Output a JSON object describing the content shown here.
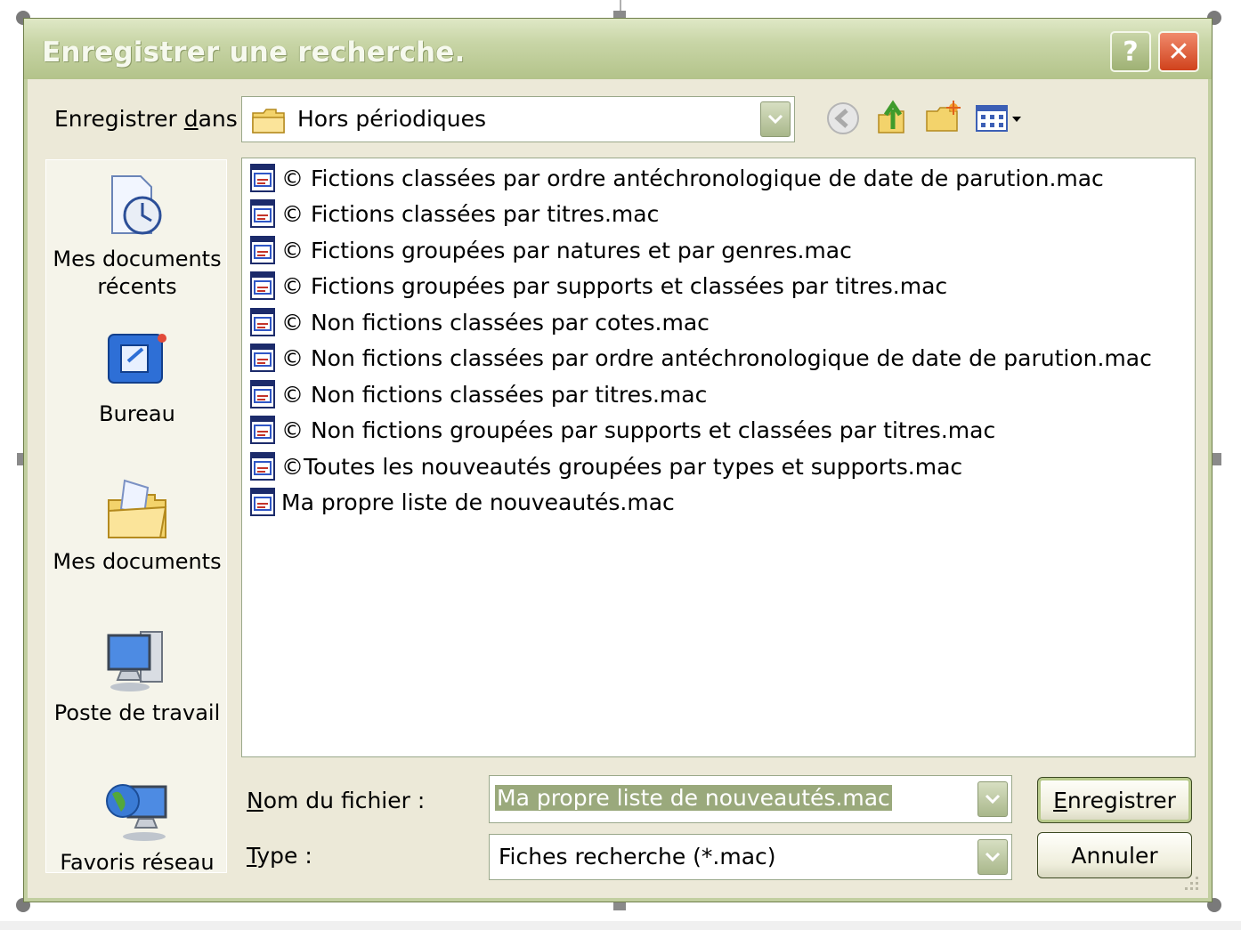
{
  "window": {
    "title": "Enregistrer une recherche."
  },
  "titlebar": {
    "help_label": "?",
    "close_label": "✕"
  },
  "toolbar": {
    "save_in_label_pre": "Enregistrer ",
    "save_in_label_accel": "d",
    "save_in_label_post": "ans :",
    "location": "Hors périodiques"
  },
  "places": [
    {
      "label_line1": "Mes documents",
      "label_line2": "récents",
      "icon": "recent-documents-icon"
    },
    {
      "label_line1": "Bureau",
      "label_line2": "",
      "icon": "desktop-icon"
    },
    {
      "label_line1": "Mes documents",
      "label_line2": "",
      "icon": "my-documents-icon"
    },
    {
      "label_line1": "Poste de travail",
      "label_line2": "",
      "icon": "my-computer-icon"
    },
    {
      "label_line1": "Favoris réseau",
      "label_line2": "",
      "icon": "network-places-icon"
    }
  ],
  "files": [
    "© Fictions classées par ordre antéchronologique de date de parution.mac",
    "© Fictions classées par titres.mac",
    "© Fictions groupées par natures et par genres.mac",
    "© Fictions groupées par supports et classées par titres.mac",
    "© Non fictions classées par cotes.mac",
    "© Non fictions classées par ordre antéchronologique de date de parution.mac",
    "© Non fictions classées par titres.mac",
    "© Non fictions groupées par supports et classées par titres.mac",
    "©Toutes les nouveautés groupées par types et supports.mac",
    "Ma propre liste de nouveautés.mac"
  ],
  "form": {
    "filename_label_accel": "N",
    "filename_label_rest": "om du fichier :",
    "filename_value": "Ma propre liste de nouveautés.mac",
    "type_label_accel": "T",
    "type_label_rest": "ype :",
    "type_value": "Fiches recherche (*.mac)"
  },
  "buttons": {
    "save_accel": "E",
    "save_rest": "nregistrer",
    "cancel": "Annuler"
  }
}
